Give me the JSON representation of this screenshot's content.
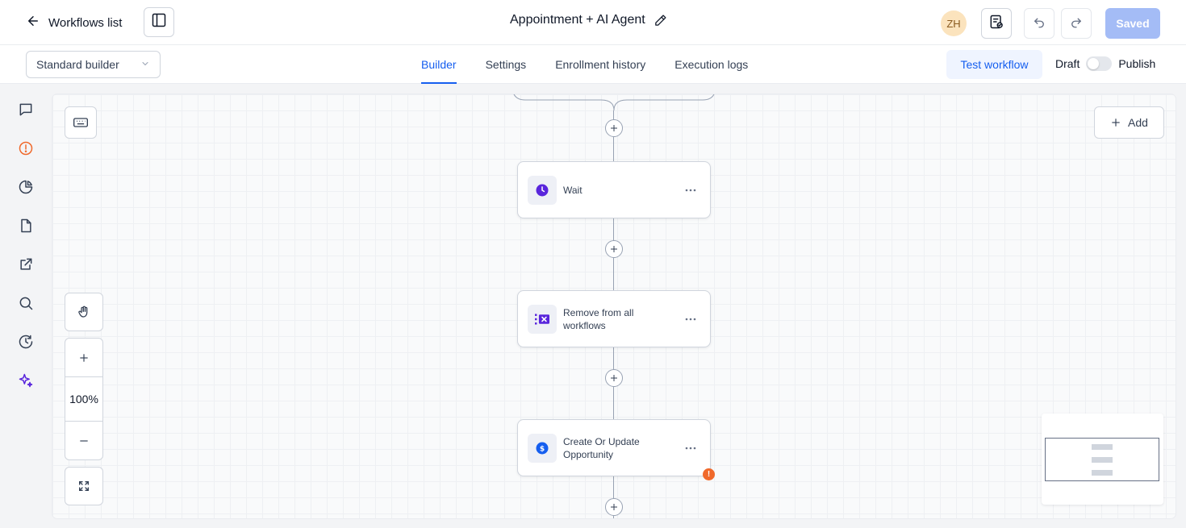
{
  "header": {
    "back_label": "Workflows list",
    "workflow_title": "Appointment + AI Agent",
    "avatar_initials": "ZH",
    "saved_label": "Saved"
  },
  "subbar": {
    "builder_select": "Standard builder",
    "tabs": [
      {
        "label": "Builder",
        "active": true
      },
      {
        "label": "Settings",
        "active": false
      },
      {
        "label": "Enrollment history",
        "active": false
      },
      {
        "label": "Execution logs",
        "active": false
      }
    ],
    "test_label": "Test workflow",
    "draft_label": "Draft",
    "publish_label": "Publish"
  },
  "sidebar": {
    "items": [
      {
        "icon": "chat-icon"
      },
      {
        "icon": "alert-icon",
        "color": "#f0692b"
      },
      {
        "icon": "pie-chart-icon"
      },
      {
        "icon": "document-icon"
      },
      {
        "icon": "external-link-icon"
      },
      {
        "icon": "search-icon"
      },
      {
        "icon": "history-icon"
      },
      {
        "icon": "sparkles-icon",
        "color": "#5925dc"
      }
    ]
  },
  "canvas": {
    "add_label": "Add",
    "zoom_level": "100%",
    "nodes": [
      {
        "label": "Wait",
        "icon": "clock-icon",
        "icon_color": "#5925dc"
      },
      {
        "label": "Remove from all workflows",
        "icon": "remove-workflows-icon",
        "icon_color": "#5925dc"
      },
      {
        "label": "Create Or Update Opportunity",
        "icon": "dollar-icon",
        "icon_color": "#155eef",
        "warning": "!"
      }
    ]
  }
}
